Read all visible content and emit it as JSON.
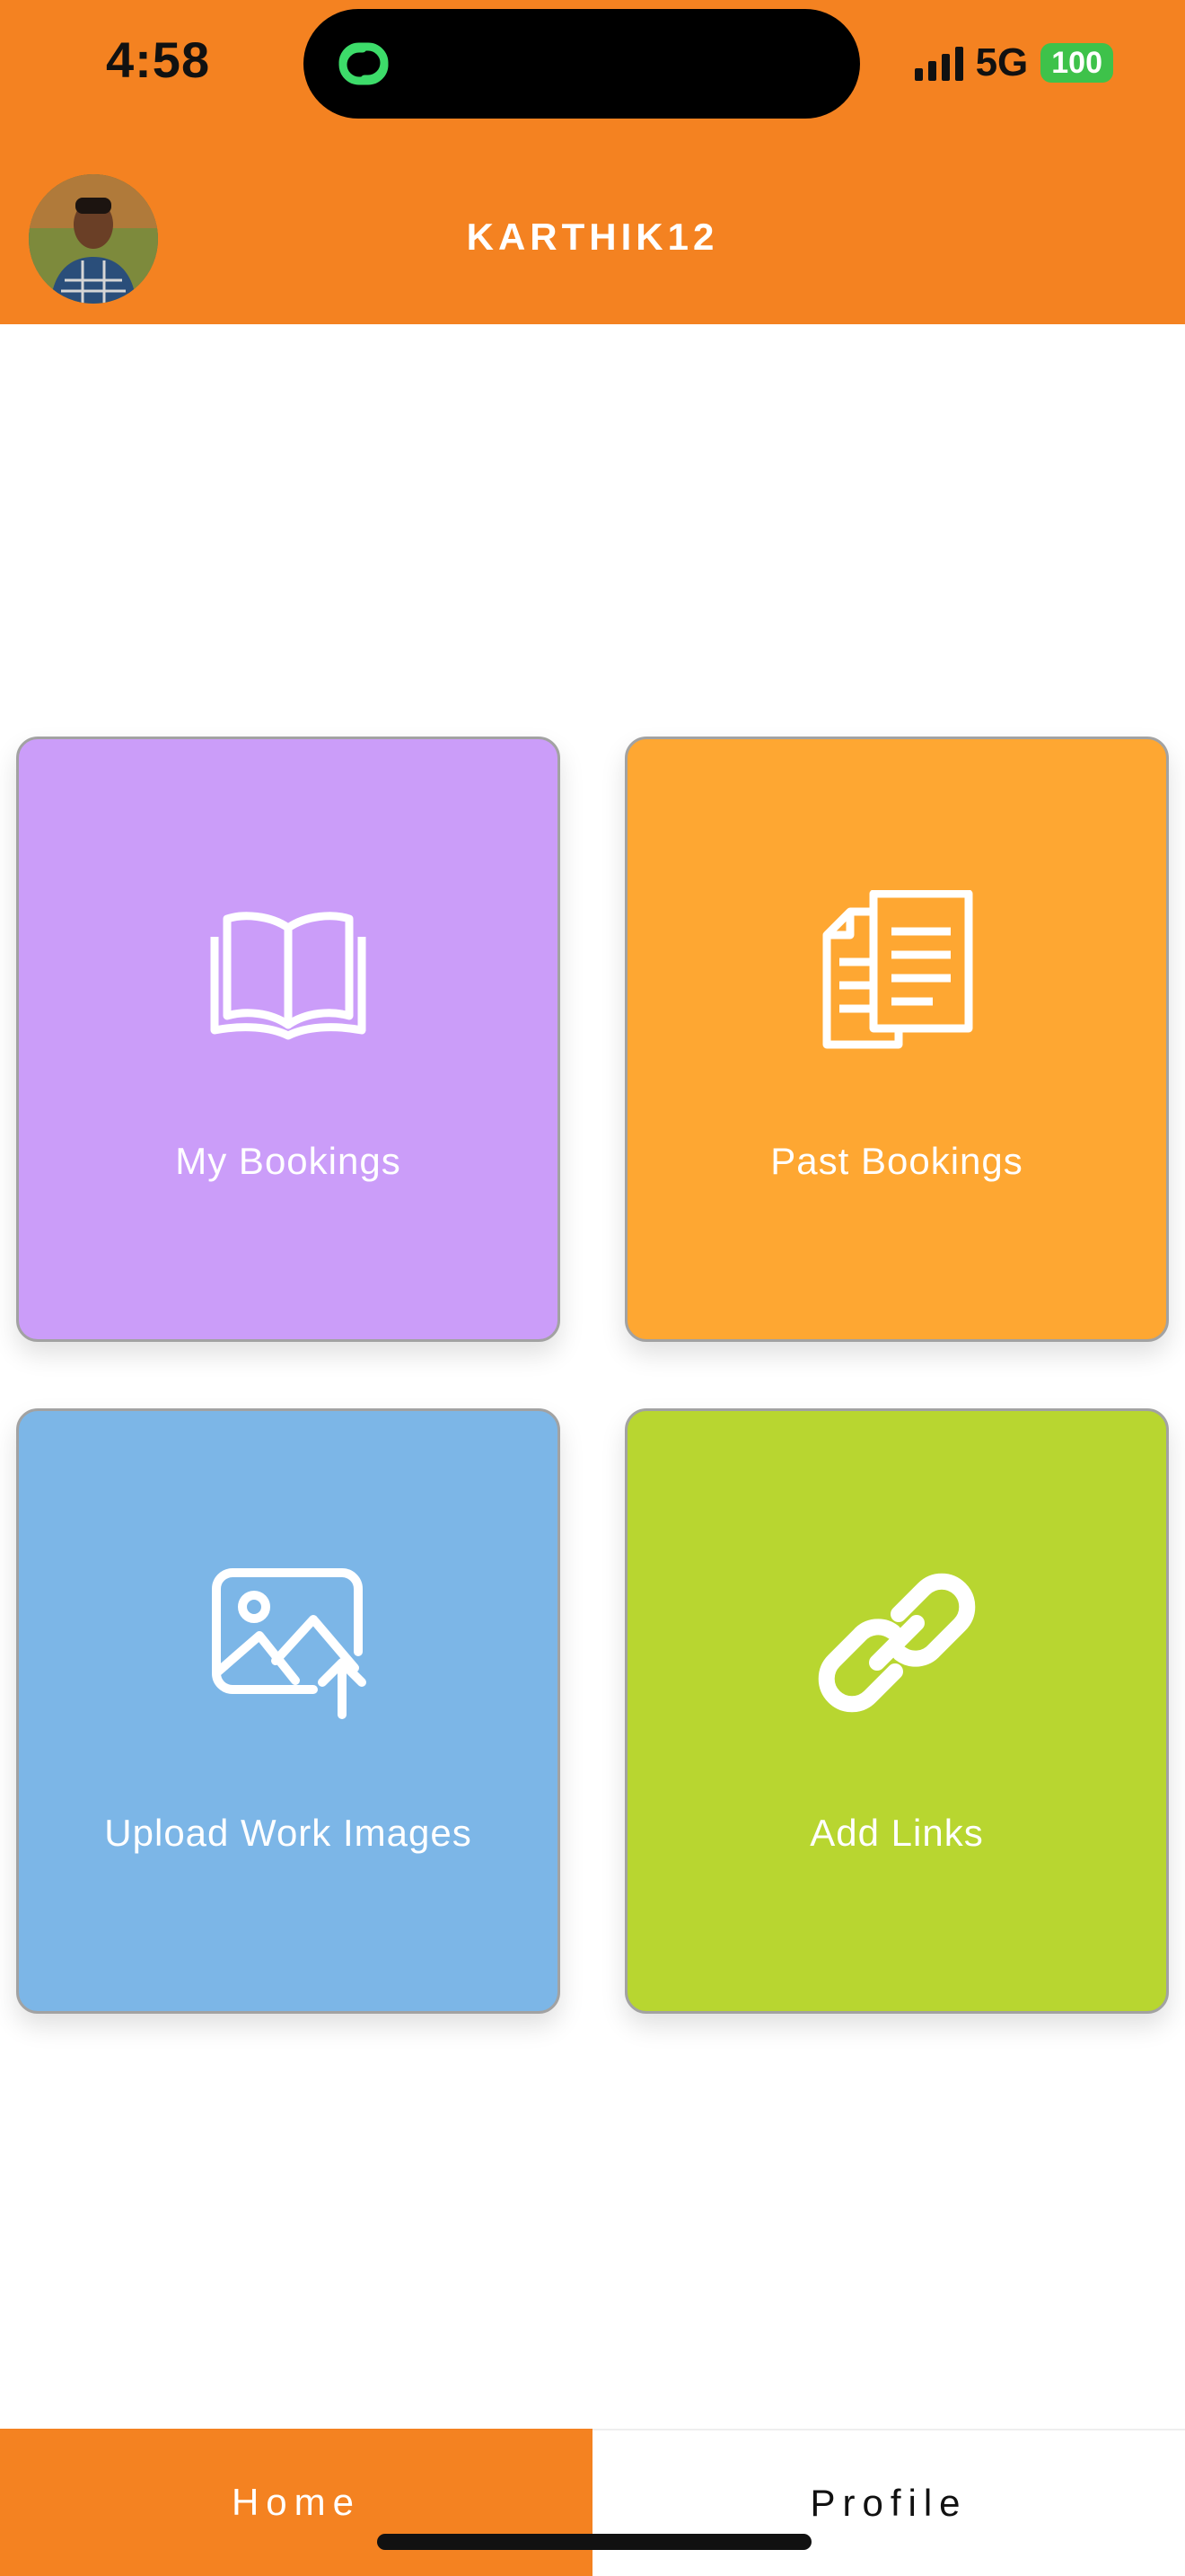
{
  "status_bar": {
    "time": "4:58",
    "network": "5G",
    "battery": "100"
  },
  "header": {
    "username": "KARTHIK12"
  },
  "tiles": [
    {
      "label": "My Bookings",
      "icon": "open-book-icon",
      "color": "#cb9df9"
    },
    {
      "label": "Past Bookings",
      "icon": "documents-icon",
      "color": "#fea732"
    },
    {
      "label": "Upload Work Images",
      "icon": "image-upload-icon",
      "color": "#7cb6e7"
    },
    {
      "label": "Add Links",
      "icon": "link-icon",
      "color": "#b8d630"
    }
  ],
  "tabs": [
    {
      "label": "Home",
      "active": true
    },
    {
      "label": "Profile",
      "active": false
    }
  ],
  "colors": {
    "brand": "#f48221",
    "battery": "#3ec24a"
  }
}
